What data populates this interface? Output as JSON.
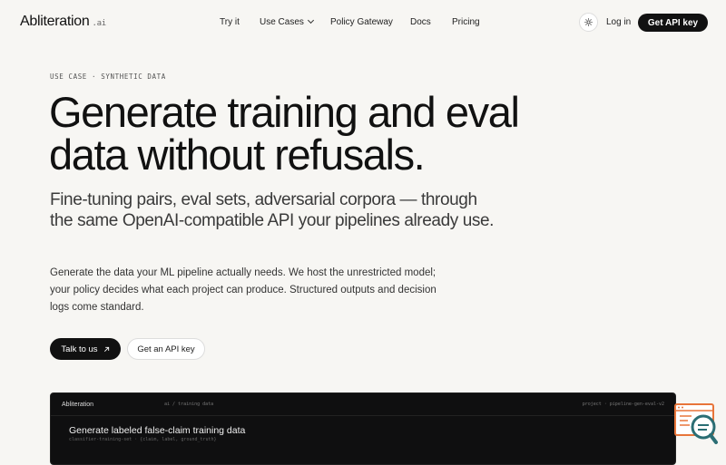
{
  "nav": {
    "logo": "Abliteration",
    "logo_suffix": ".ai",
    "links": {
      "try_it": "Try it",
      "use_cases": "Use Cases",
      "policy_gateway": "Policy Gateway",
      "docs": "Docs",
      "pricing": "Pricing"
    },
    "login": "Log in",
    "cta": "Get API key",
    "theme_icon": "sun-icon"
  },
  "hero": {
    "eyebrow": "USE CASE · SYNTHETIC DATA",
    "title_line1": "Generate training and eval",
    "title_line2": "data without refusals.",
    "subtitle": "Fine-tuning pairs, eval sets, adversarial corpora — through the same OpenAI-compatible API your pipelines already use.",
    "body": "Generate the data your ML pipeline actually needs. We host the unrestricted model; your policy decides what each project can produce. Structured outputs and decision logs come standard.",
    "primary_button": "Talk to us",
    "secondary_button": "Get an API key"
  },
  "panel": {
    "brand": "Abliteration",
    "breadcrumb": "ai / training data",
    "project": "project · pipeline-gen-eval-v2",
    "title": "Generate labeled false-claim training data",
    "meta": "classifier-training-set · {claim, label, ground_truth}"
  },
  "colors": {
    "background": "#f7f6f3",
    "dark": "#111111",
    "widget_orange": "#e8753a",
    "widget_teal": "#2b6e74"
  }
}
